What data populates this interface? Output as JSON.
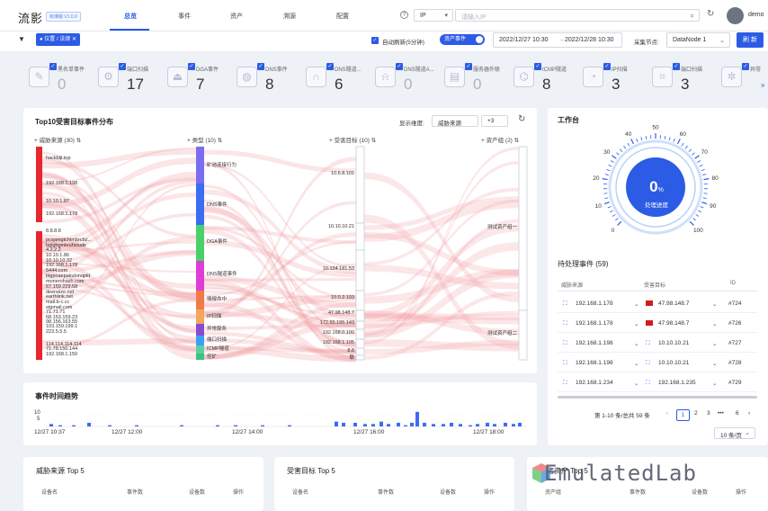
{
  "app": {
    "logo": "流影",
    "version": "标准版 V1.0.0",
    "user": "demo"
  },
  "nav": [
    "总览",
    "事件",
    "资产",
    "溯源",
    "配置"
  ],
  "search": {
    "type": "IP",
    "placeholder": "请输入IP"
  },
  "toolbar": {
    "tag": "● 位置 / 法律",
    "auto_refresh": "自动刷新(5分钟)",
    "asset_event": "资产事件",
    "time_start": "2022/12/27 10:30",
    "time_end": "2022/12/28 10:30",
    "node_label": "采集节点:",
    "node": "DataNode 1",
    "refresh_btn": "刷 新"
  },
  "stats": [
    {
      "label": "黑名单事件",
      "value": "0",
      "icon": "blacklist-icon"
    },
    {
      "label": "端口扫描",
      "value": "17",
      "icon": "port-scan-icon"
    },
    {
      "label": "DGA事件",
      "value": "7",
      "icon": "dga-icon"
    },
    {
      "label": "DNS事件",
      "value": "8",
      "icon": "dns-icon"
    },
    {
      "label": "DNS隧道...",
      "value": "6",
      "icon": "tunnel-icon"
    },
    {
      "label": "DNS隧道A...",
      "value": "0",
      "icon": "alarm-icon"
    },
    {
      "label": "服务器外联",
      "value": "0",
      "icon": "server-icon"
    },
    {
      "label": "ICMP隧道",
      "value": "8",
      "icon": "icmp-icon"
    },
    {
      "label": "IP扫描",
      "value": "3",
      "icon": "ip-scan-icon"
    },
    {
      "label": "端口扫描",
      "value": "3",
      "icon": "scan-frame-icon"
    },
    {
      "label": "异常",
      "value": "",
      "icon": "gear-icon"
    }
  ],
  "sankey": {
    "title": "Top10受害目标事件分布",
    "display": "显示维度:",
    "dim": "威胁来源",
    "more": "+3",
    "cols": [
      "+ 威胁来源 (30) ⇅",
      "+ 类型 (10) ⇅",
      "+ 受害目标 (10) ⇅",
      "+ 资产组 (2) ⇅"
    ],
    "sources": [
      "hackbiji.top",
      "192.168.1.198",
      "10.10.1.87",
      "192.168.1.178",
      "8.8.8.8",
      "pcqamgtchtmbrcbz...",
      "bgigbgmkruhxiude",
      "4.2.2.2",
      "10.10.1.86",
      "10.10.10.32",
      "192.168.1.178",
      "5444.com",
      "bigpoaepakulunqpkt",
      "monerohash.com",
      "67.159.229.58",
      "deerwize.net",
      "earthlink.net",
      "mail.b-c.cc",
      "stgmail.com",
      "71.71.71",
      "68.153.159.23",
      "98.156.163.55",
      "103.159.199.1",
      "223.5.5.5",
      "114.114.114.114",
      "71.78.150.144",
      "192.168.1.150"
    ],
    "types": [
      "矿池连接行为",
      "DNS事件",
      "DGA事件",
      "DNS隧道事件",
      "情报命中",
      "IP扫描",
      "异常服务",
      "端口扫描",
      "ICMP隧道",
      "挖矿"
    ],
    "targets": [
      "10.6.8.101",
      "10.10.10.21",
      "10.134.181.53",
      "10.0.2.103",
      "47.98.148.7",
      "172.65.195.143",
      "192.168.0.100",
      "192.168.1.105",
      "8.8",
      "联"
    ],
    "groups": [
      "测试资产组一",
      "测试资产组二"
    ]
  },
  "timeline": {
    "title": "事件时间趋势",
    "ylabels": [
      "10",
      "5"
    ],
    "xlabels": [
      "12/27 10:37",
      "12/27 12:00",
      "12/27 14:00",
      "12/27 16:00",
      "12/27 18:00"
    ]
  },
  "workbench": {
    "title": "工作台",
    "gauge_value": "0",
    "gauge_unit": "%",
    "gauge_label": "处理进度",
    "ticks": [
      "0",
      "10",
      "20",
      "30",
      "40",
      "50",
      "60",
      "70",
      "80",
      "90",
      "100"
    ]
  },
  "pending": {
    "title": "待处理事件 (59)",
    "headers": [
      "威胁来源",
      "受害目标",
      "ID"
    ],
    "rows": [
      {
        "src": "192.168.1.178",
        "dst": "47.98.148.7",
        "id": "#724",
        "flag": true
      },
      {
        "src": "192.168.1.178",
        "dst": "47.98.148.7",
        "id": "#726",
        "flag": true
      },
      {
        "src": "192.168.1.198",
        "dst": "10.10.10.21",
        "id": "#727",
        "flag": false
      },
      {
        "src": "192.168.1.198",
        "dst": "10.10.10.21",
        "id": "#728",
        "flag": false
      },
      {
        "src": "192.168.1.234",
        "dst": "192.168.1.235",
        "id": "#729",
        "flag": false
      }
    ],
    "pagination": {
      "summary": "第 1-10 条/总共 59 条",
      "pages": [
        "1",
        "2",
        "3",
        "•••",
        "6"
      ],
      "size": "10 条/页"
    }
  },
  "bottom": {
    "threat_title": "威胁来源 Top 5",
    "victim_title": "受害目标 Top 5",
    "asset_title": "受害资产 Top 5",
    "th1": [
      "设备名",
      "事件数",
      "设备数",
      "操作"
    ],
    "th2": [
      "设备名",
      "事件数",
      "设备数",
      "操作"
    ],
    "th3": [
      "资产组",
      "事件数",
      "设备数",
      "操作"
    ]
  },
  "watermark": "EmulatedLab"
}
